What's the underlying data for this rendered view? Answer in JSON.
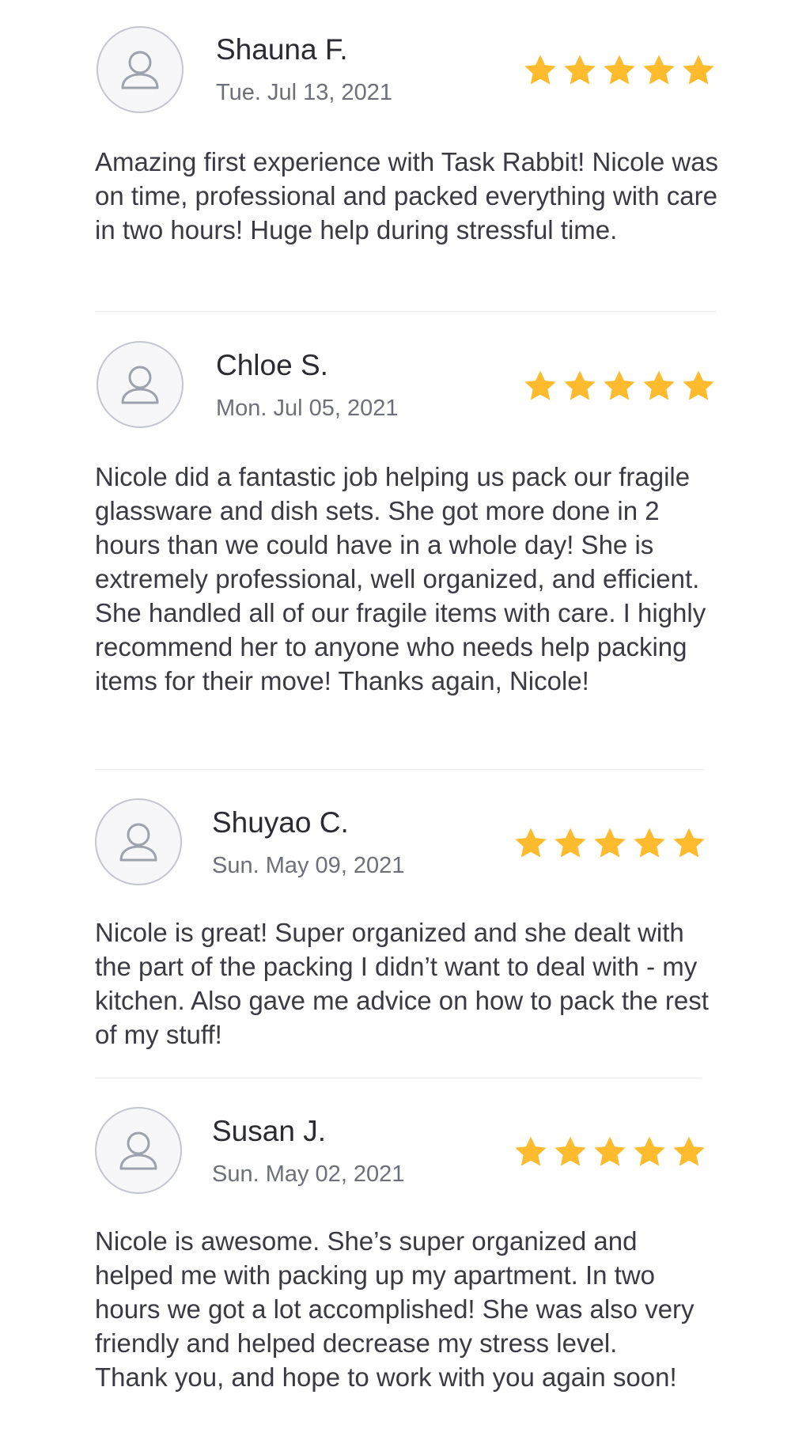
{
  "accent_color": "#fdbb2d",
  "reviews": [
    {
      "name": "Shauna F.",
      "date": "Tue. Jul 13, 2021",
      "rating": 5,
      "avatar_icon": "user-icon",
      "text": "Amazing first experience with Task Rabbit! Nicole was on time, professional and packed everything with care in two hours! Huge help during stressful time."
    },
    {
      "name": "Chloe S.",
      "date": "Mon. Jul 05, 2021",
      "rating": 5,
      "avatar_icon": "user-icon",
      "text": "Nicole did a fantastic job helping us pack our fragile glassware and dish sets. She got more done in 2 hours than we could have in a whole day! She is extremely professional, well organized, and efficient. She handled all of our fragile items with care. I highly recommend her to anyone who needs help packing items for their move! Thanks again, Nicole!"
    },
    {
      "name": "Shuyao C.",
      "date": "Sun. May 09, 2021",
      "rating": 5,
      "avatar_icon": "user-icon",
      "text": "Nicole is great! Super organized and she dealt with the part of the packing I didn’t want to deal with - my kitchen. Also gave me advice on how to pack the rest of my stuff!"
    },
    {
      "name": "Susan J.",
      "date": "Sun. May 02, 2021",
      "rating": 5,
      "avatar_icon": "user-icon",
      "text": "Nicole is awesome. She’s super organized and helped me with packing up my apartment. In two hours we got a lot accomplished! She was also very friendly and helped decrease my stress level. Thank you, and hope to work with you again soon!"
    }
  ]
}
